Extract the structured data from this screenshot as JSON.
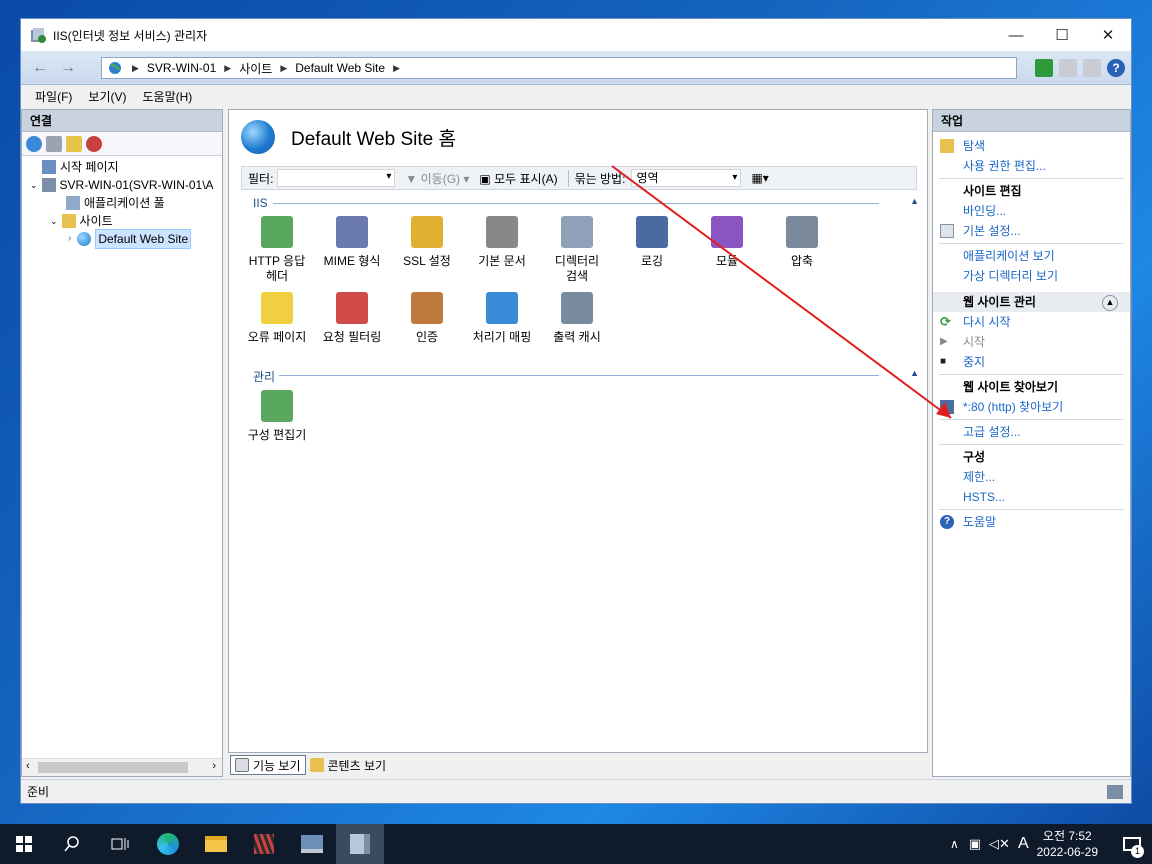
{
  "window": {
    "title": "IIS(인터넷 정보 서비스) 관리자"
  },
  "window_controls": {
    "minimize": "—",
    "maximize": "☐",
    "close": "✕"
  },
  "nav": {
    "back": "←",
    "forward": "→",
    "breadcrumb": [
      "SVR-WIN-01",
      "사이트",
      "Default Web Site"
    ]
  },
  "menu": [
    "파일(F)",
    "보기(V)",
    "도움말(H)"
  ],
  "connections": {
    "title": "연결",
    "tree": {
      "start_page": "시작 페이지",
      "server": "SVR-WIN-01(SVR-WIN-01\\A",
      "app_pools": "애플리케이션 풀",
      "sites": "사이트",
      "default_site": "Default Web Site"
    }
  },
  "center": {
    "title": "Default Web Site 홈",
    "filter_label": "필터:",
    "go_label": "이동(G)",
    "show_all_label": "모두 표시(A)",
    "group_by_label": "묶는 방법:",
    "group_by_value": "영역",
    "sections": [
      {
        "name": "IIS",
        "features": [
          "HTTP 응답\n헤더",
          "MIME 형식",
          "SSL 설정",
          "기본 문서",
          "디렉터리\n검색",
          "로깅",
          "모듈",
          "압축",
          "오류 페이지",
          "요청 필터링",
          "인증",
          "처리기 매핑",
          "출력 캐시"
        ]
      },
      {
        "name": "관리",
        "features": [
          "구성 편집기"
        ]
      }
    ]
  },
  "view_tabs": {
    "features": "기능 보기",
    "content": "콘텐츠 보기"
  },
  "actions": {
    "title": "작업",
    "explore": "탐색",
    "edit_permissions": "사용 권한 편집...",
    "edit_site_head": "사이트 편집",
    "bindings": "바인딩...",
    "basic_settings": "기본 설정...",
    "view_applications": "애플리케이션 보기",
    "view_virtual_dirs": "가상 디렉터리 보기",
    "manage_site_head": "웹 사이트 관리",
    "restart": "다시 시작",
    "start": "시작",
    "stop": "중지",
    "browse_head": "웹 사이트 찾아보기",
    "browse_80": "*:80 (http) 찾아보기",
    "advanced_settings": "고급 설정...",
    "config_head": "구성",
    "limits": "제한...",
    "hsts": "HSTS...",
    "help": "도움말"
  },
  "status": {
    "text": "준비"
  },
  "taskbar": {
    "clock_line1": "오전 7:52",
    "clock_line2": "2022-06-29",
    "ime": "A",
    "notif_count": "1"
  },
  "colors": {
    "link": "#1a66c7",
    "annotation_arrow": "#e02020"
  }
}
